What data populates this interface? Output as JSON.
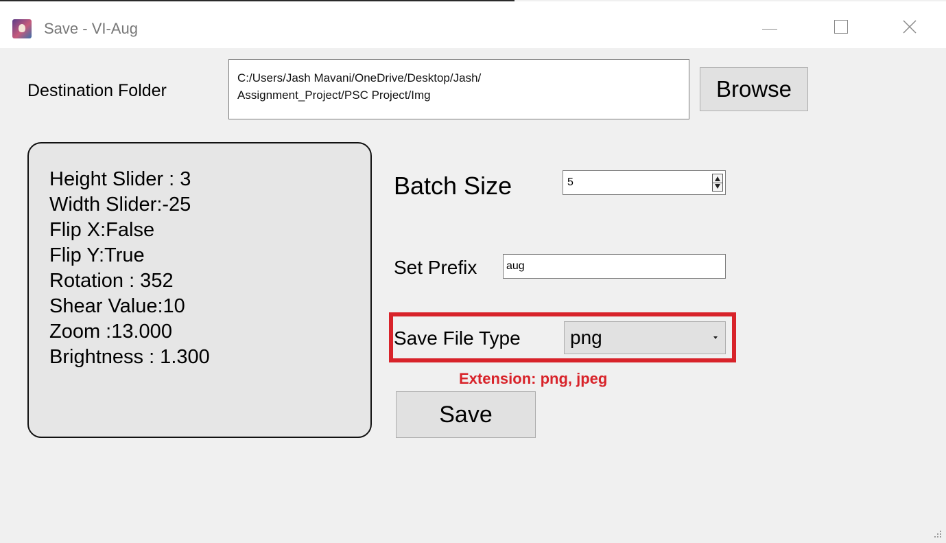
{
  "window": {
    "title": "Save - VI-Aug",
    "icon": "app-icon",
    "controls": {
      "minimize": "minimize-icon",
      "maximize": "maximize-icon",
      "close": "close-icon"
    }
  },
  "destination": {
    "label": "Destination Folder",
    "path_line1": "C:/Users/Jash Mavani/OneDrive/Desktop/Jash/",
    "path_line2": "Assignment_Project/PSC Project/Img",
    "browse_label": "Browse"
  },
  "parameters": [
    "Height Slider : 3",
    "Width Slider:-25",
    "Flip X:False",
    "Flip Y:True",
    "Rotation : 352",
    "Shear Value:10",
    "Zoom :13.000",
    "Brightness : 1.300"
  ],
  "batch": {
    "label": "Batch Size",
    "value": "5"
  },
  "prefix": {
    "label": "Set Prefix",
    "value": "aug"
  },
  "file_type": {
    "label": "Save File Type",
    "selected": "png",
    "note": "Extension: png, jpeg",
    "highlight_color": "#d8232a"
  },
  "save_label": "Save"
}
